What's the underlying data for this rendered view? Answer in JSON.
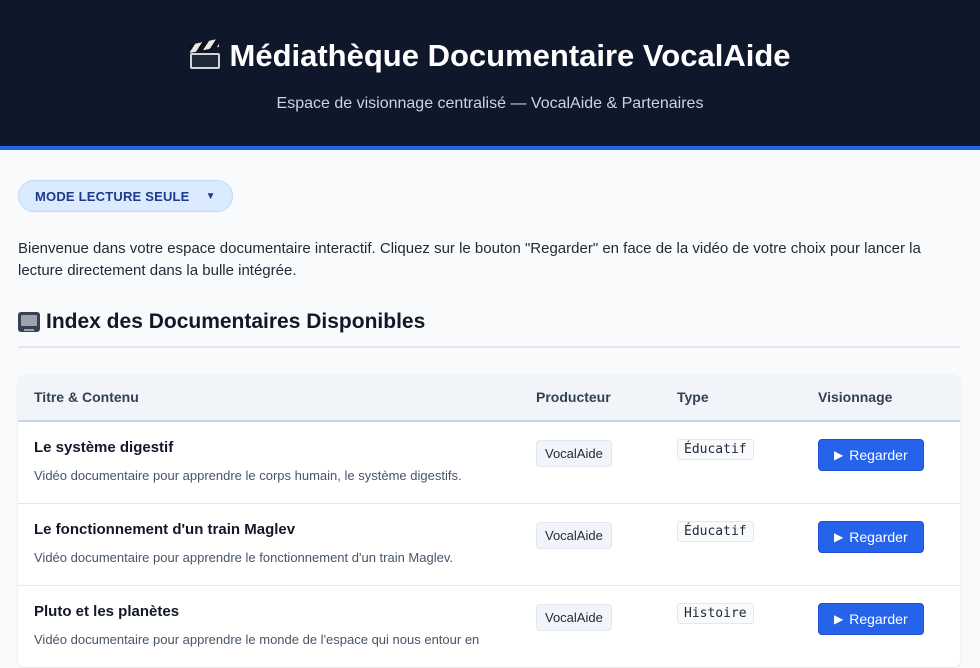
{
  "header": {
    "title": "Médiathèque Documentaire VocalAide",
    "title_icon": "clapperboard-icon",
    "subtitle": "Espace de visionnage centralisé — VocalAide & Partenaires"
  },
  "mode": {
    "label": "MODE LECTURE SEULE",
    "caret": "▼"
  },
  "intro": "Bienvenue dans votre espace documentaire interactif. Cliquez sur le bouton \"Regarder\" en face de la vidéo de votre choix pour lancer la lecture directement dans la bulle intégrée.",
  "section": {
    "title": "Index des Documentaires Disponibles",
    "icon": "television-icon"
  },
  "table": {
    "headers": [
      "Titre & Contenu",
      "Producteur",
      "Type",
      "Visionnage"
    ],
    "rows": [
      {
        "title": "Le système digestif",
        "desc": "Vidéo documentaire pour apprendre le corps humain, le système digestifs.",
        "producer": "VocalAide",
        "type": "Éducatif",
        "action": "Regarder"
      },
      {
        "title": "Le fonctionnement d'un train Maglev",
        "desc": "Vidéo documentaire pour apprendre le fonctionnement d'un train Maglev.",
        "producer": "VocalAide",
        "type": "Éducatif",
        "action": "Regarder"
      },
      {
        "title": "Pluto et les planètes",
        "desc": "Vidéo documentaire pour apprendre le monde de l'espace qui nous entour en",
        "producer": "VocalAide",
        "type": "Histoire",
        "action": "Regarder"
      }
    ]
  },
  "colors": {
    "header_bg": "#0f172a",
    "accent": "#2563eb",
    "pill_bg": "#dbeafe"
  }
}
